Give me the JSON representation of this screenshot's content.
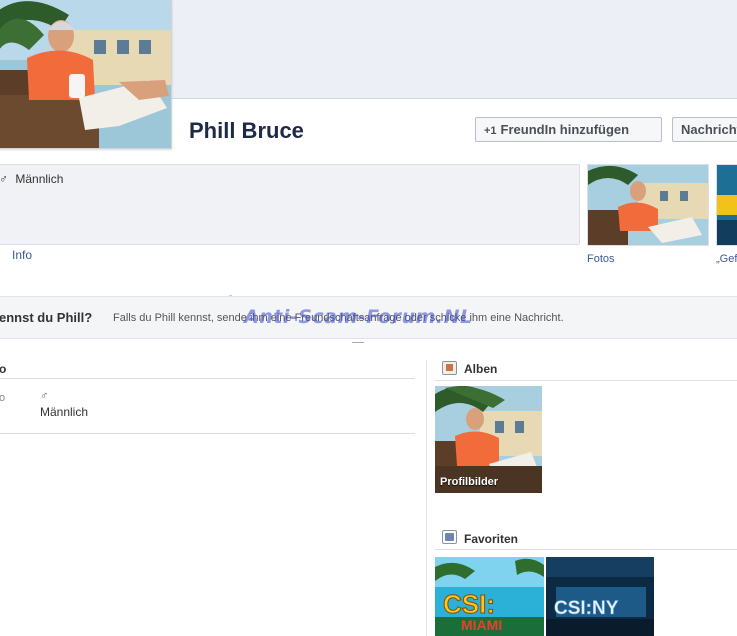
{
  "profile": {
    "name": "Phill Bruce",
    "gender_symbol": "♂",
    "gender": "Männlich"
  },
  "actions": {
    "add_friend_label": "FreundIn hinzufügen",
    "message_label": "Nachricht"
  },
  "intro": {
    "info_link": "Info"
  },
  "thumbnails": [
    {
      "caption": "Fotos"
    },
    {
      "caption": "„Gef"
    }
  ],
  "know_bar": {
    "title": "ennst du Phill?",
    "text": "Falls du Phill kennst, sende ihm eine Freundschaftsanfrage oder schicke ihm eine Nachricht.",
    "watermark": "Anti-Scam-Forum.NL"
  },
  "info_section": {
    "title": "o",
    "row_label": "o",
    "gender_symbol": "♂",
    "gender": "Männlich"
  },
  "albums": {
    "title": "Alben",
    "items": [
      {
        "label": "Profilbilder"
      }
    ]
  },
  "favorites": {
    "title": "Favoriten",
    "items": [
      {
        "name": "CSI: Miami",
        "logo_text_top": "CSI:",
        "logo_text_bottom": "MIAMI"
      },
      {
        "name": "CSI: NY",
        "logo_text": "CSI:NY"
      }
    ]
  },
  "colors": {
    "link": "#3b5998",
    "name": "#1c2a47",
    "cover": "#eceff5",
    "watermark": "#3c4bc8"
  }
}
